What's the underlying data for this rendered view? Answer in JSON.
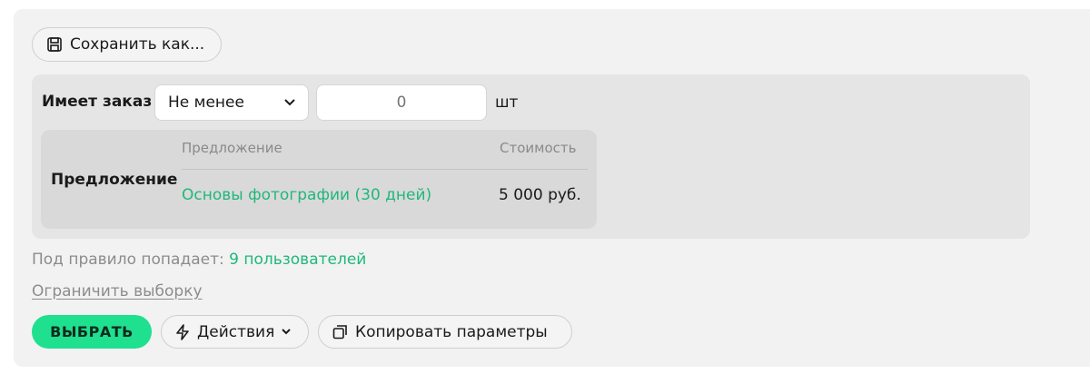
{
  "toolbar": {
    "save_as_label": "Сохранить как..."
  },
  "rule": {
    "label": "Имеет заказ",
    "comparator": "Не менее",
    "quantity_value": "",
    "quantity_placeholder": "0",
    "unit": "шт"
  },
  "offer": {
    "label": "Предложение",
    "columns": {
      "name": "Предложение",
      "price": "Стоимость"
    },
    "rows": [
      {
        "name": "Основы фотографии (30 дней)",
        "price": "5 000 руб."
      }
    ]
  },
  "stats": {
    "prefix": "Под правило попадает:",
    "count_link": "9 пользователей"
  },
  "limit_link": "Ограничить выборку",
  "actions": {
    "select_label": "ВЫБРАТЬ",
    "actions_label": "Действия",
    "copy_label": "Копировать параметры"
  },
  "colors": {
    "accent": "#1ee08e",
    "link": "#1fb87a",
    "panel": "#f2f2f2"
  }
}
